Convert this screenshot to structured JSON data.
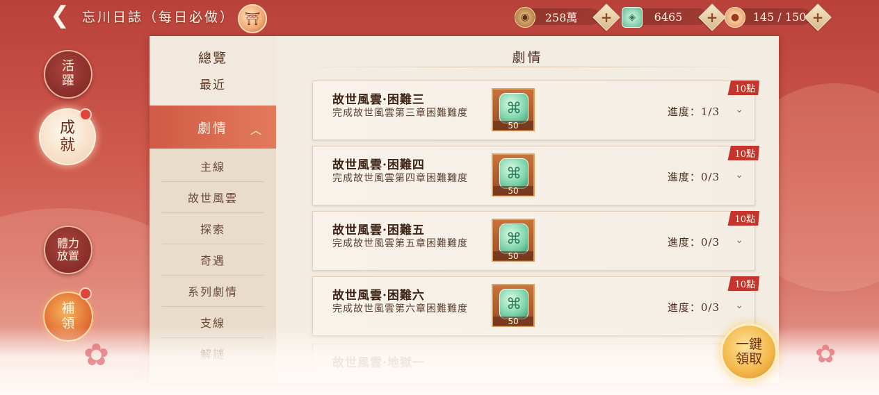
{
  "header": {
    "title": "忘川日誌（每日必做）",
    "badge_icon": "shrine-icon",
    "resources": [
      {
        "name": "coin",
        "icon": "coin-icon",
        "value": "258萬"
      },
      {
        "name": "jade",
        "icon": "jade-icon",
        "value": "6465"
      },
      {
        "name": "stamina",
        "icon": "food-icon",
        "value": "145 / 150"
      }
    ]
  },
  "left_nav": {
    "activity": "活躍",
    "achievement": "成就",
    "stamina_idle": "體力放置",
    "supplement": "補領"
  },
  "sidebar": {
    "overview": "總覽",
    "recent": "最近",
    "category": "劇情",
    "items": [
      "主線",
      "故世風雲",
      "探索",
      "奇遇",
      "系列劇情",
      "支線",
      "解謎"
    ]
  },
  "content": {
    "title": "劇情",
    "cards": [
      {
        "name": "故世風雲·困難三",
        "desc": "完成故世風雲第三章困難難度",
        "reward_count": "50",
        "progress": "進度：1/3",
        "points": "10點"
      },
      {
        "name": "故世風雲·困難四",
        "desc": "完成故世風雲第四章困難難度",
        "reward_count": "50",
        "progress": "進度：0/3",
        "points": "10點"
      },
      {
        "name": "故世風雲·困難五",
        "desc": "完成故世風雲第五章困難難度",
        "reward_count": "50",
        "progress": "進度：0/3",
        "points": "10點"
      },
      {
        "name": "故世風雲·困難六",
        "desc": "完成故世風雲第六章困難難度",
        "reward_count": "50",
        "progress": "進度：0/3",
        "points": "10點"
      }
    ],
    "partial_card_name": "故世風雲·地獄一"
  },
  "claim_all": "一鍵領取",
  "colors": {
    "accent_red": "#c6352d",
    "background": "#cf5a4d",
    "panel": "#efe7dc",
    "selected_tab": "#d05a45"
  }
}
